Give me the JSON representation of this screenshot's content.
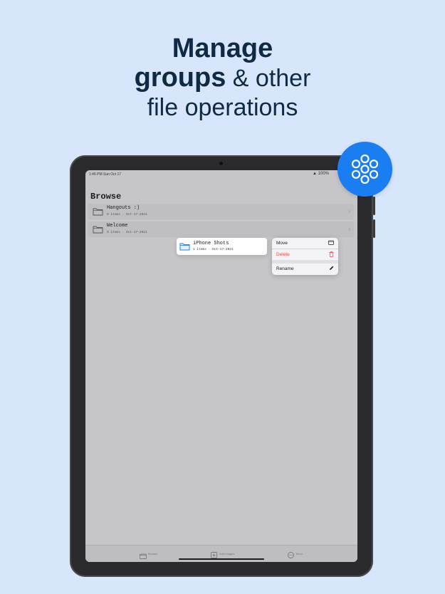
{
  "headline": {
    "line1": "Manage",
    "line2_bold": "groups",
    "line2_rest": " & other",
    "line3": "file operations"
  },
  "status_bar": {
    "time": "1:46 PM  Sun Oct 17",
    "right": "▲ 100%"
  },
  "browse": {
    "title": "Browse",
    "folders": [
      {
        "name": "Hangouts :)",
        "meta": "0 items · Oct-17-2021"
      },
      {
        "name": "Welcome",
        "meta": "3 items · Oct-17-2021"
      }
    ]
  },
  "preview": {
    "name": "iPhone Shots",
    "meta": "1 items · Oct-17-2021"
  },
  "context_menu": {
    "items": [
      {
        "label": "Move",
        "icon": "folder-icon"
      },
      {
        "label": "Delete",
        "icon": "trash-icon"
      },
      {
        "label": "Rename",
        "icon": "pencil-icon"
      }
    ]
  },
  "tab_bar": {
    "tabs": [
      {
        "label": "Browse",
        "icon": "folder-icon"
      },
      {
        "label": "Add Images",
        "icon": "add-photo-icon"
      },
      {
        "label": "More",
        "icon": "more-icon"
      }
    ]
  },
  "colors": {
    "background": "#d7e6fb",
    "headline": "#0f2a44",
    "accent": "#1a7df2",
    "danger": "#ff3b30"
  },
  "badge_icon": "group-circles-icon"
}
